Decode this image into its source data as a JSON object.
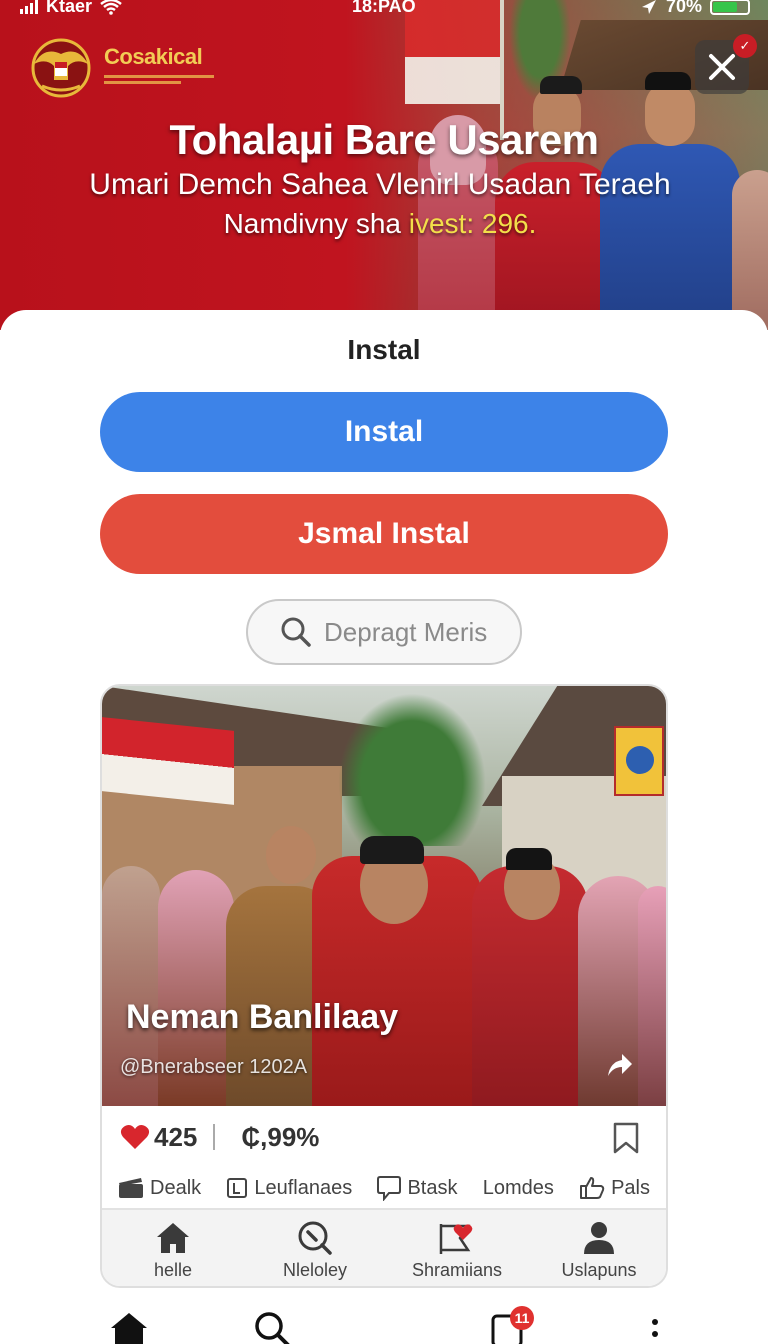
{
  "status_bar": {
    "carrier": "Ktaer",
    "time": "18:PAO",
    "battery": "70%"
  },
  "banner": {
    "logo_text": "Cosakical",
    "headline": "Tohalaµi Bare Usarem",
    "subline": "Umari Demch Sahea Vlenirl Usadan Teraeh",
    "subline2_prefix": "Namdivny sha ",
    "subline2_highlight": "ivest: 296.",
    "close_badge": "✓"
  },
  "sheet": {
    "title": "Instal",
    "primary_button": "Instal",
    "secondary_button": "Jsmal Instal",
    "search_placeholder": "Depragt Meris"
  },
  "card": {
    "title": "Neman Banlilaay",
    "handle": "@Bnerabseer 1202A",
    "likes": "425",
    "percent": "₵,99%",
    "actions": [
      {
        "icon": "clapper-icon",
        "label": "Dealk"
      },
      {
        "icon": "tag-box-icon",
        "label": "Leuflanaes"
      },
      {
        "icon": "chat-bubble-icon",
        "label": "Btask"
      },
      {
        "icon": "",
        "label": "Lomdes"
      },
      {
        "icon": "thumbs-up-icon",
        "label": "Pals"
      }
    ],
    "tabs": [
      {
        "icon": "home-icon",
        "label": "helle"
      },
      {
        "icon": "search-icon",
        "label": "Nleloley"
      },
      {
        "icon": "heart-flag-icon",
        "label": "Shramiians"
      },
      {
        "icon": "person-icon",
        "label": "Uslapuns"
      }
    ]
  },
  "bottom_nav": {
    "notification_count": "11"
  },
  "colors": {
    "brand_red": "#c0141f",
    "primary_blue": "#3d83e8",
    "secondary_red": "#e34d3d",
    "heart_red": "#d8262d"
  }
}
